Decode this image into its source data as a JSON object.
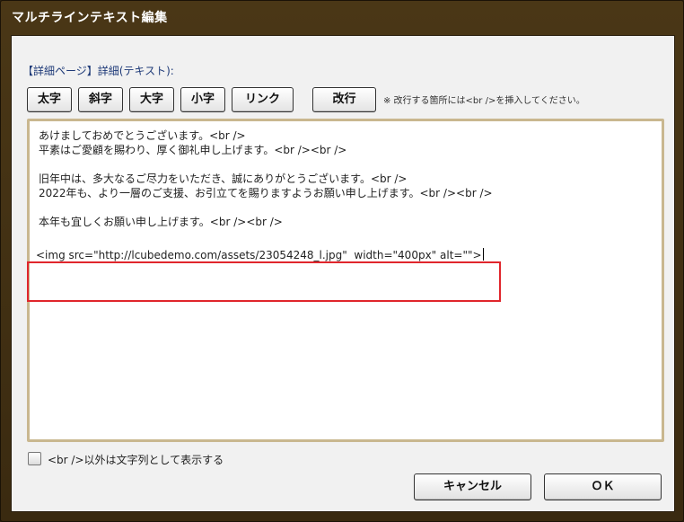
{
  "window": {
    "title": "マルチラインテキスト編集"
  },
  "section": {
    "label": "【詳細ページ】詳細(テキスト):"
  },
  "toolbar": {
    "bold": "太字",
    "italic": "斜字",
    "large": "大字",
    "small": "小字",
    "link": "リンク",
    "newline": "改行",
    "note": "※ 改行する箇所には<br />を挿入してください。"
  },
  "editor": {
    "lines": [
      "あけましておめでとうございます。<br />",
      "平素はご愛顧を賜わり、厚く御礼申し上げます。<br /><br />",
      "",
      "旧年中は、多大なるご尽力をいただき、誠にありがとうございます。<br />",
      "2022年も、より一層のご支援、お引立てを賜りますようお願い申し上げます。<br /><br />",
      "",
      "本年も宜しくお願い申し上げます。<br /><br />",
      "",
      "<img src=\"http://lcubedemo.com/assets/23054248_l.jpg\"  width=\"400px\" alt=\"\">"
    ]
  },
  "options": {
    "show_as_string": "<br />以外は文字列として表示する",
    "show_as_string_checked": false
  },
  "footer": {
    "cancel": "キャンセル",
    "ok": "ＯＫ"
  }
}
